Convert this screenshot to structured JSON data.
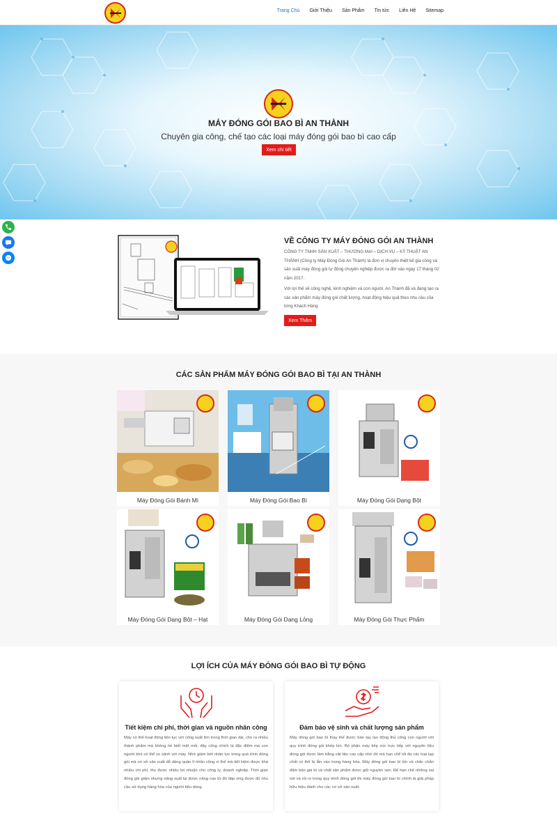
{
  "nav": {
    "items": [
      {
        "label": "Trang Chủ",
        "active": true
      },
      {
        "label": "Giới Thiệu"
      },
      {
        "label": "Sản Phẩm"
      },
      {
        "label": "Tin tức"
      },
      {
        "label": "Liên Hệ"
      },
      {
        "label": "Sitemap"
      }
    ]
  },
  "hero": {
    "title": "MÁY ĐÓNG GÓI BAO BÌ AN THÀNH",
    "subtitle": "Chuyên gia công, chế tạo các loại máy đóng gói bao bì cao cấp",
    "button": "Xem chi tiết"
  },
  "about": {
    "title": "VỀ CÔNG TY MÁY ĐÓNG GÓI AN THÀNH",
    "paragraph1": "CÔNG TY TNHH SẢN XUẤT – THƯƠNG MẠI – DỊCH VỤ – KỸ THUẬT AN THÀNH (Công ty Máy Đóng Gói An Thành) là đơn vị chuyên thiết kế gia công và sản xuất máy đóng gói tự động chuyên nghiệp được ra đời vào ngày 17 tháng 02 năm 2017.",
    "paragraph2": "Với lợi thế về công nghệ, kinh nghiệm và con người, An Thành đã và đang tạo ra các sản phẩm máy đóng gói chất lượng, hoạt động hiệu quả theo nhu cầu của từng Khách Hàng",
    "button": "Xem Thêm"
  },
  "products": {
    "title": "CÁC SẢN PHẨM MÁY ĐÓNG GÓI BAO BÌ TẠI AN THÀNH",
    "items": [
      {
        "name": "Máy Đóng Gói Bánh Mì"
      },
      {
        "name": "Máy Đóng Gói Bao Bì"
      },
      {
        "name": "Máy Đóng Gói Dạng Bột"
      },
      {
        "name": "Máy Đóng Gói Dạng Bột – Hạt"
      },
      {
        "name": "Máy Đóng Gói Dạng Lỏng"
      },
      {
        "name": "Máy Đóng Gói Thực Phẩm"
      }
    ]
  },
  "benefits": {
    "title": "LỢI ÍCH CỦA MÁY ĐÓNG GÓI BAO BÌ TỰ ĐỘNG",
    "items": [
      {
        "title": "Tiết kiệm chi phí, thời gian và nguồn nhân công",
        "text": "Máy có thể hoạt động liên tục với công suất lớn trong thời gian dài, cho ra nhiều thành phẩm mà không hề biết mệt mỏi, đây cũng chính là đặc điểm mà con người khó có thể so sánh với máy. Nhờ giảm bớt nhân lực trong quá trình đóng gói mà cơ sở sản xuất dễ dàng quản lí nhân công vì thế mà tiết kiệm được khá nhiều chi phí, thu được nhiều lợi nhuận cho công ty, doanh nghiệp. Thời gian đóng gói giảm nhưng năng suất lại được nâng cao từ đó đáp ứng được đủ nhu cầu sử dụng hàng hóa của người tiêu dùng."
      },
      {
        "title": "Đảm bảo vệ sinh và chất lượng sản phẩm",
        "text": "Máy đóng gói bao bì thay thế được bàn tay lao động thủ công con người với quy trình đóng gói khép kín. Bộ phận máy tiếp xúc trực tiếp với nguyên liệu đóng gói được làm bằng vật liệu cao cấp nhờ đó mà hạn chế tối đa các loại tạp chất có thể bị lẫn vào trong hàng hóa. Máy đóng gói bao bì kín và chắc chắn đảm bảo giá trị và chất sản phẩm được giữ nguyên vẹn. Để hạn chế những sai sót và rủi ro trong quy trình đóng gói thì máy đóng gói bao bì chính là giải pháp hữu hiệu dành cho các cơ sở sản xuất."
      }
    ]
  },
  "colors": {
    "accent_red": "#e21b1b",
    "nav_active": "#1e73be",
    "logo_yellow": "#f6d21d"
  }
}
